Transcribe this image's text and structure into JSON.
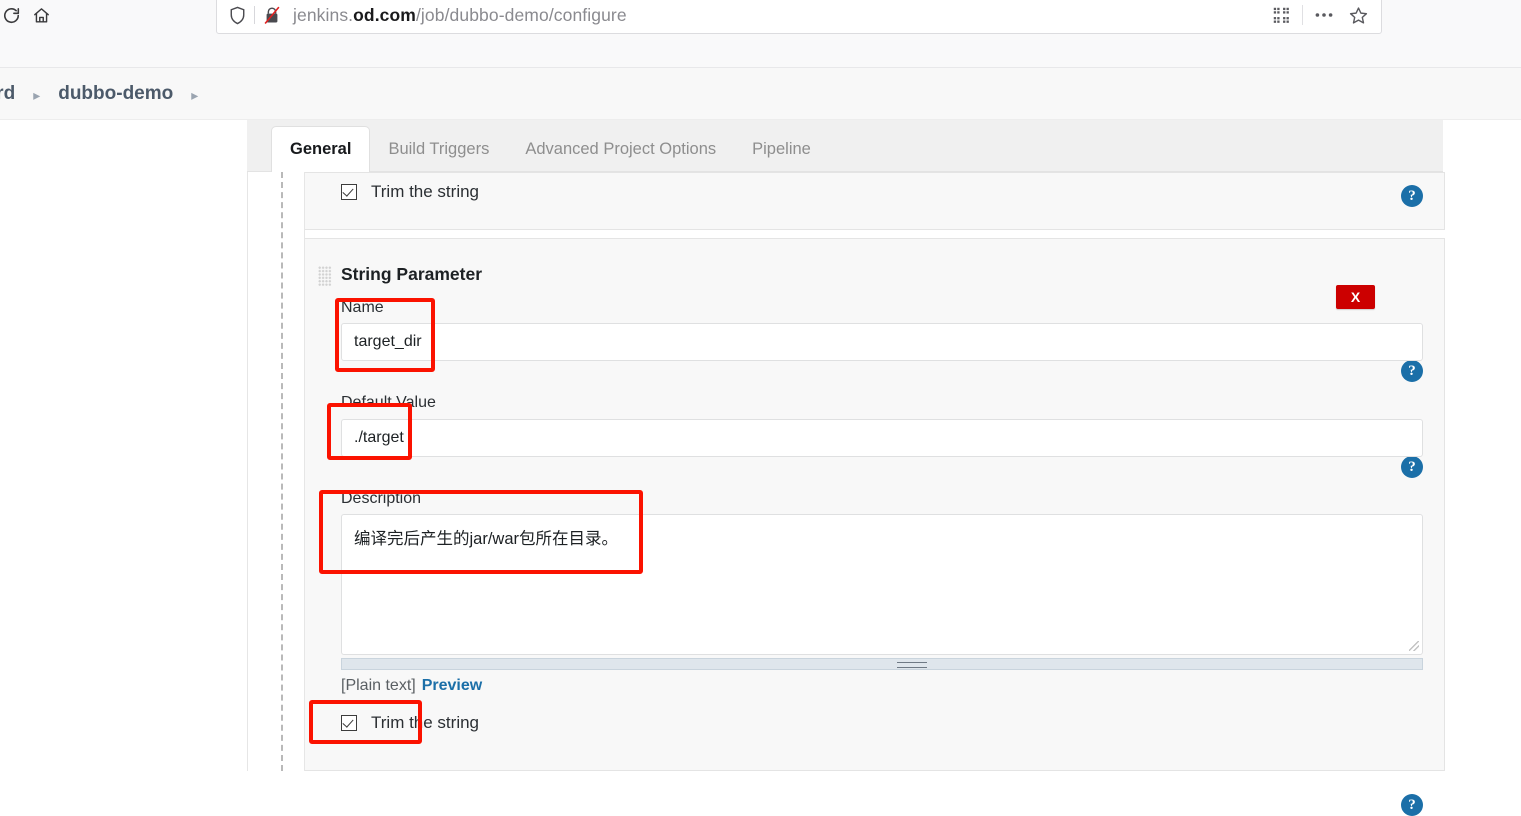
{
  "browser": {
    "reload_icon": "reload-icon",
    "home_icon": "home-icon",
    "shield_icon": "shield-icon",
    "tracker_blocked_icon": "tracker-blocked-icon",
    "url_prefix": "jenkins.",
    "url_host": "od.com",
    "url_path": "/job/dubbo-demo/configure",
    "url_full": "jenkins.od.com/job/dubbo-demo/configure",
    "actions": [
      {
        "name": "qr-code-icon",
        "title": "QR code"
      },
      {
        "name": "more-options-icon",
        "title": "More"
      },
      {
        "name": "bookmark-star-icon",
        "title": "Bookmark"
      }
    ]
  },
  "breadcrumb": {
    "items": [
      {
        "label": "oard"
      },
      {
        "label": "dubbo-demo"
      }
    ],
    "separator": "▸"
  },
  "tabs": [
    {
      "label": "General",
      "active": true
    },
    {
      "label": "Build Triggers",
      "active": false
    },
    {
      "label": "Advanced Project Options",
      "active": false
    },
    {
      "label": "Pipeline",
      "active": false
    }
  ],
  "form": {
    "top_trim_label": "Trim the string",
    "top_trim_checked": true,
    "parameter_title": "String Parameter",
    "delete_label": "X",
    "name_label": "Name",
    "name_value": "target_dir",
    "default_label": "Default Value",
    "default_value": "./target",
    "description_label": "Description",
    "description_value": "编译完后产生的jar/war包所在目录。",
    "markup_format": "[Plain text]",
    "preview_label": "Preview",
    "bottom_trim_label": "Trim the string",
    "bottom_trim_checked": true,
    "help_icon_glyph": "?"
  },
  "colors": {
    "accent_blue": "#1b6fa8",
    "delete_red": "#cc0000",
    "annotation_red": "#fb1200",
    "panel_bg": "#f8f8f8",
    "tabbar_bg": "#f0f0f0"
  },
  "annotations": [
    {
      "name": "annotation-name-field"
    },
    {
      "name": "annotation-default-value-field"
    },
    {
      "name": "annotation-description-field"
    },
    {
      "name": "annotation-trim-checkbox"
    }
  ]
}
